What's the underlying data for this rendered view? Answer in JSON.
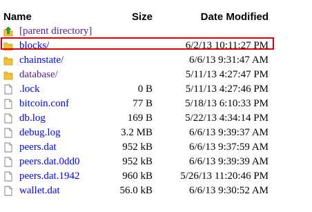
{
  "header": {
    "name": "Name",
    "size": "Size",
    "date_modified": "Date Modified"
  },
  "parent": {
    "label": "[parent directory]",
    "icon": "up-arrow-folder-icon"
  },
  "entries": [
    {
      "name": "blocks/",
      "size": "",
      "date": "6/2/13 10:11:27 PM",
      "type": "folder",
      "visited": false,
      "highlighted": true
    },
    {
      "name": "chainstate/",
      "size": "",
      "date": "6/6/13 9:31:47 AM",
      "type": "folder",
      "visited": false,
      "highlighted": false
    },
    {
      "name": "database/",
      "size": "",
      "date": "5/11/13 4:27:47 PM",
      "type": "folder",
      "visited": true,
      "highlighted": false
    },
    {
      "name": ".lock",
      "size": "0 B",
      "date": "5/11/13 4:27:46 PM",
      "type": "file",
      "visited": false,
      "highlighted": false
    },
    {
      "name": "bitcoin.conf",
      "size": "77 B",
      "date": "5/18/13 6:10:33 PM",
      "type": "file",
      "visited": false,
      "highlighted": false
    },
    {
      "name": "db.log",
      "size": "169 B",
      "date": "5/22/13 4:34:14 PM",
      "type": "file",
      "visited": false,
      "highlighted": false
    },
    {
      "name": "debug.log",
      "size": "3.2 MB",
      "date": "6/6/13 9:39:37 AM",
      "type": "file",
      "visited": false,
      "highlighted": false
    },
    {
      "name": "peers.dat",
      "size": "952 kB",
      "date": "6/6/13 9:37:59 AM",
      "type": "file",
      "visited": false,
      "highlighted": false
    },
    {
      "name": "peers.dat.0dd0",
      "size": "952 kB",
      "date": "6/6/13 9:39:39 AM",
      "type": "file",
      "visited": false,
      "highlighted": false
    },
    {
      "name": "peers.dat.1942",
      "size": "960 kB",
      "date": "5/26/13 11:20:46 PM",
      "type": "file",
      "visited": false,
      "highlighted": false
    },
    {
      "name": "wallet.dat",
      "size": "56.0 kB",
      "date": "6/6/13 9:30:52 AM",
      "type": "file",
      "visited": false,
      "highlighted": false
    }
  ],
  "colors": {
    "link": "#0000ee",
    "visited_link": "#551a8b",
    "folder_icon": "#f5c338",
    "highlight_border": "#e00000"
  }
}
